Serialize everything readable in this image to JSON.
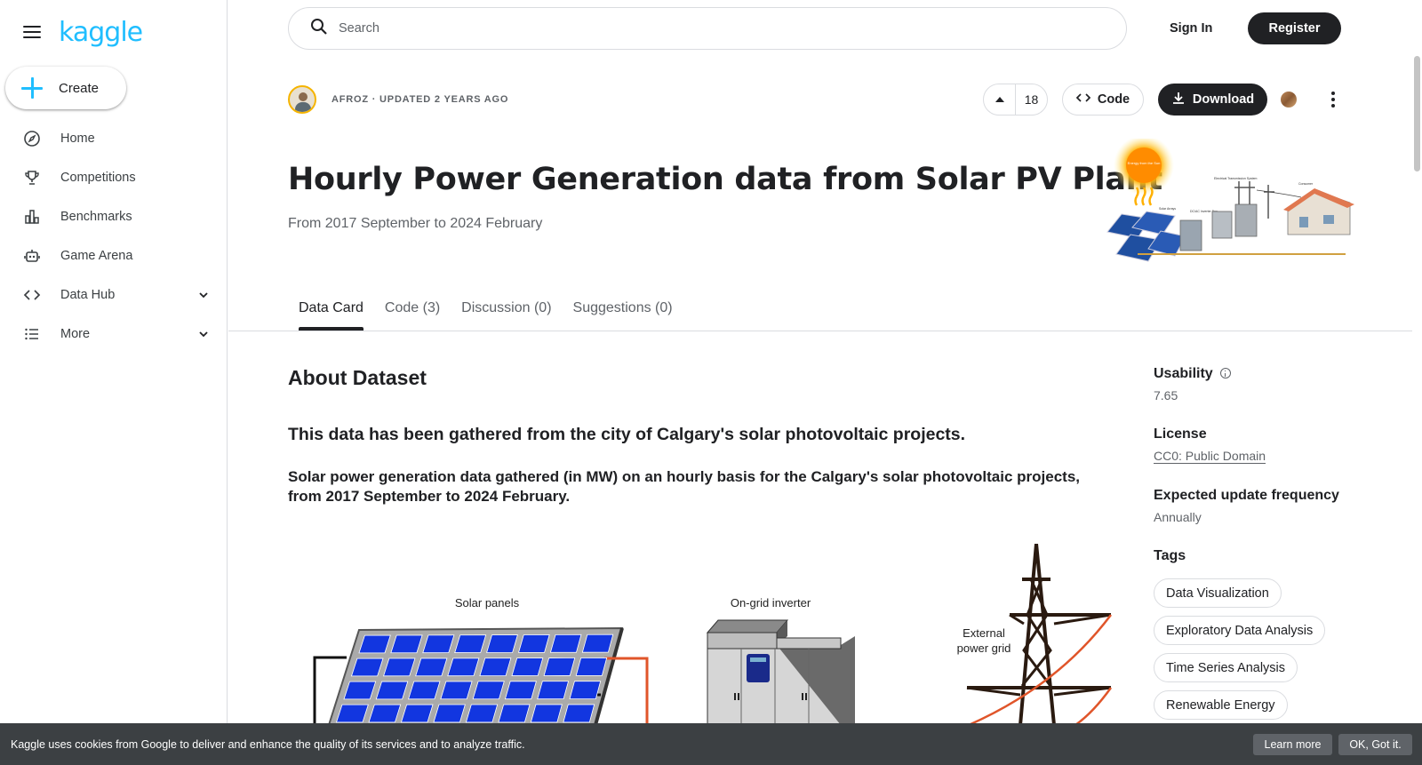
{
  "sidebar": {
    "logo": "kaggle",
    "create_label": "Create",
    "items": [
      {
        "label": "Home",
        "icon": "compass-icon"
      },
      {
        "label": "Competitions",
        "icon": "trophy-icon"
      },
      {
        "label": "Benchmarks",
        "icon": "bar-chart-icon"
      },
      {
        "label": "Game Arena",
        "icon": "robot-icon"
      },
      {
        "label": "Data Hub",
        "icon": "code-icon",
        "expandable": true
      },
      {
        "label": "More",
        "icon": "list-icon",
        "expandable": true
      }
    ]
  },
  "topbar": {
    "search_placeholder": "Search",
    "sign_in": "Sign In",
    "register": "Register"
  },
  "dataset": {
    "author_line": "AFROZ · UPDATED 2 YEARS AGO",
    "upvotes": "18",
    "code_button": "Code",
    "download_button": "Download",
    "title": "Hourly Power Generation data from Solar PV Plant",
    "subtitle": "From 2017 September to 2024 February",
    "header_image_labels": {
      "sun": "Energy from the Sun",
      "arrays": "Solar Arrays",
      "inverter": "DC/AC Inverter Box",
      "transmission": "Electrical Transmission System",
      "consumer": "Consumer"
    }
  },
  "tabs": [
    {
      "label": "Data Card",
      "active": true
    },
    {
      "label": "Code (3)",
      "active": false
    },
    {
      "label": "Discussion (0)",
      "active": false
    },
    {
      "label": "Suggestions (0)",
      "active": false
    }
  ],
  "about": {
    "heading": "About Dataset",
    "paragraph1": "This data has been gathered from the city of Calgary's solar photovoltaic projects.",
    "paragraph2": "Solar power generation data gathered (in MW) on an hourly basis for the Calgary's solar photovoltaic projects, from 2017 September to 2024 February.",
    "diagram_labels": {
      "panels": "Solar panels",
      "inverter": "On-grid inverter",
      "grid_line1": "External",
      "grid_line2": "power grid"
    }
  },
  "meta": {
    "usability_label": "Usability",
    "usability_value": "7.65",
    "license_label": "License",
    "license_value": "CC0: Public Domain",
    "frequency_label": "Expected update frequency",
    "frequency_value": "Annually",
    "tags_label": "Tags",
    "tags": [
      "Data Visualization",
      "Exploratory Data Analysis",
      "Time Series Analysis",
      "Renewable Energy"
    ]
  },
  "cookie": {
    "text": "Kaggle uses cookies from Google to deliver and enhance the quality of its services and to analyze traffic.",
    "learn_more": "Learn more",
    "ok": "OK, Got it."
  },
  "colors": {
    "brand": "#20beff",
    "dark": "#202124",
    "muted": "#5f6368",
    "border": "#dadce0",
    "cookie_bg": "#3c4043"
  }
}
